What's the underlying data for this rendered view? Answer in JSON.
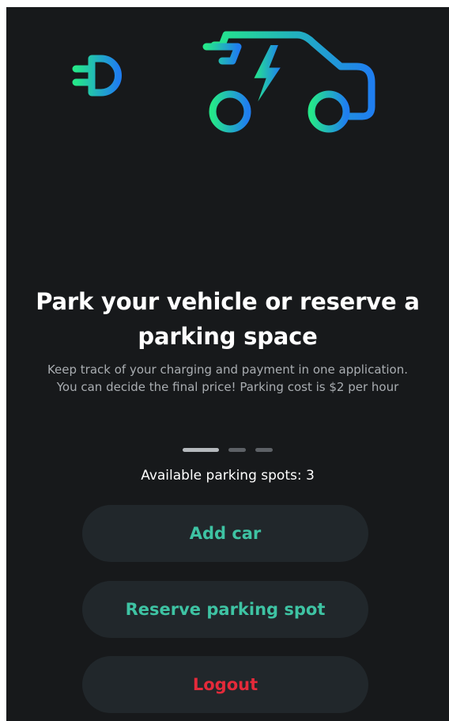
{
  "hero": {
    "icon": "electric-car-plug-icon",
    "gradient_start": "#25e78a",
    "gradient_end": "#1f7ef0"
  },
  "onboarding": {
    "title": "Park your vehicle or reserve a parking space",
    "description": "Keep track of your charging and payment in one application. You can decide the final price! Parking cost is $2 per hour",
    "page_indicator": {
      "current": 1,
      "total": 3
    }
  },
  "status": {
    "available_text": "Available parking spots: 3"
  },
  "actions": {
    "add_car": "Add car",
    "reserve": "Reserve parking spot",
    "logout": "Logout"
  },
  "colors": {
    "background": "#17191b",
    "button_bg": "#21272b",
    "accent": "#3ec3a3",
    "danger": "#e42a3a"
  }
}
